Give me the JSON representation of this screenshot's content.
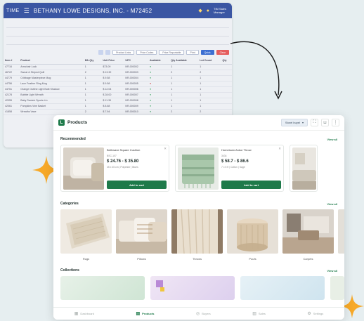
{
  "legacy": {
    "time_label": "TIME",
    "title": "BETHANY LOWE DESIGNS, INC. - M72452",
    "user_label": "TIM Sales Manager",
    "toolbar_buttons": [
      "Product Links",
      "Price Codes",
      "Price Reportable",
      "Print",
      "Quick",
      "Clear"
    ],
    "columns": [
      "Item #",
      "Product",
      "Mfr Qty",
      "Unit Price",
      "UPC",
      "Available",
      "Qty Available",
      "Lot Count",
      "Qty"
    ],
    "rows": [
      {
        "item": "47716",
        "product": "Armchair Lock",
        "qty": "1",
        "price": "$73.09",
        "upc": "NR-000002",
        "avail": "●",
        "qa": "1",
        "lot": "1"
      },
      {
        "item": "46722",
        "product": "Sweat & Striped Quill",
        "qty": "2",
        "price": "$ 13.32",
        "upc": "NR-000003",
        "avail": "●",
        "qa": "2",
        "lot": "2"
      },
      {
        "item": "44779",
        "product": "Cribbage Masterpiece Mug",
        "qty": "1",
        "price": "$ 9.58",
        "upc": "NR-000004",
        "avail": "●",
        "qa": "1",
        "lot": "1"
      },
      {
        "item": "44756",
        "product": "Lace Feather Ring Mug",
        "qty": "1",
        "price": "$ 9.58",
        "upc": "NR-000005",
        "avail": "●",
        "qa": "1",
        "lot": "1"
      },
      {
        "item": "44751",
        "product": "Orange Outline Light Bulb Shadow",
        "qty": "1",
        "price": "$ 12.04",
        "upc": "NR-000006",
        "avail": "●",
        "qa": "1",
        "lot": "1"
      },
      {
        "item": "42178",
        "product": "Bubble Light Wreath",
        "qty": "1",
        "price": "$ 28.00",
        "upc": "NR-000007",
        "avail": "●",
        "qa": "1",
        "lot": "1"
      },
      {
        "item": "42055",
        "product": "Baby Santa's Sports Lin",
        "qty": "1",
        "price": "$ 11.39",
        "upc": "NR-000008",
        "avail": "●",
        "qa": "1",
        "lot": "1"
      },
      {
        "item": "42061",
        "product": "Pumpkins Vine Basket",
        "qty": "1",
        "price": "$ 8.68",
        "upc": "NR-000009",
        "avail": "●",
        "qa": "1",
        "lot": "1"
      },
      {
        "item": "41858",
        "product": "Wreaths Vase",
        "qty": "2",
        "price": "$ 7.94",
        "upc": "NR-000010",
        "avail": "●",
        "qa": "2",
        "lot": "2"
      }
    ]
  },
  "app": {
    "title": "Products",
    "store_select": "Storel buyel",
    "recommended": {
      "title": "Recommended",
      "view_all": "View all",
      "items": [
        {
          "name": "Bethwave Square Cushion",
          "sku": "BSC-107",
          "price": "$ 24.76 - $ 35.80",
          "meta": "45 x 45 cm  |  Polyester  |  Blues",
          "button": "Add to cart"
        },
        {
          "name": "Hometown Ankor Throw",
          "sku": "3434",
          "price": "$ 58.7 - $ 86.6",
          "meta": "7 x 5 ft  |  Cotton  |  Sage",
          "button": "Add to cart"
        }
      ]
    },
    "categories": {
      "title": "Categories",
      "view_all": "View all",
      "items": [
        "Rugs",
        "Pillows",
        "Throws",
        "Poufs",
        "Carpets"
      ]
    },
    "collections": {
      "title": "Collections",
      "view_all": "View all"
    },
    "nav": [
      "Dashboard",
      "Products",
      "Buyers",
      "Sales",
      "Settings"
    ]
  },
  "colors": {
    "brand": "#1e7a4a",
    "legacy_bar": "#3a56a3",
    "sparkle": "#f7a928"
  }
}
